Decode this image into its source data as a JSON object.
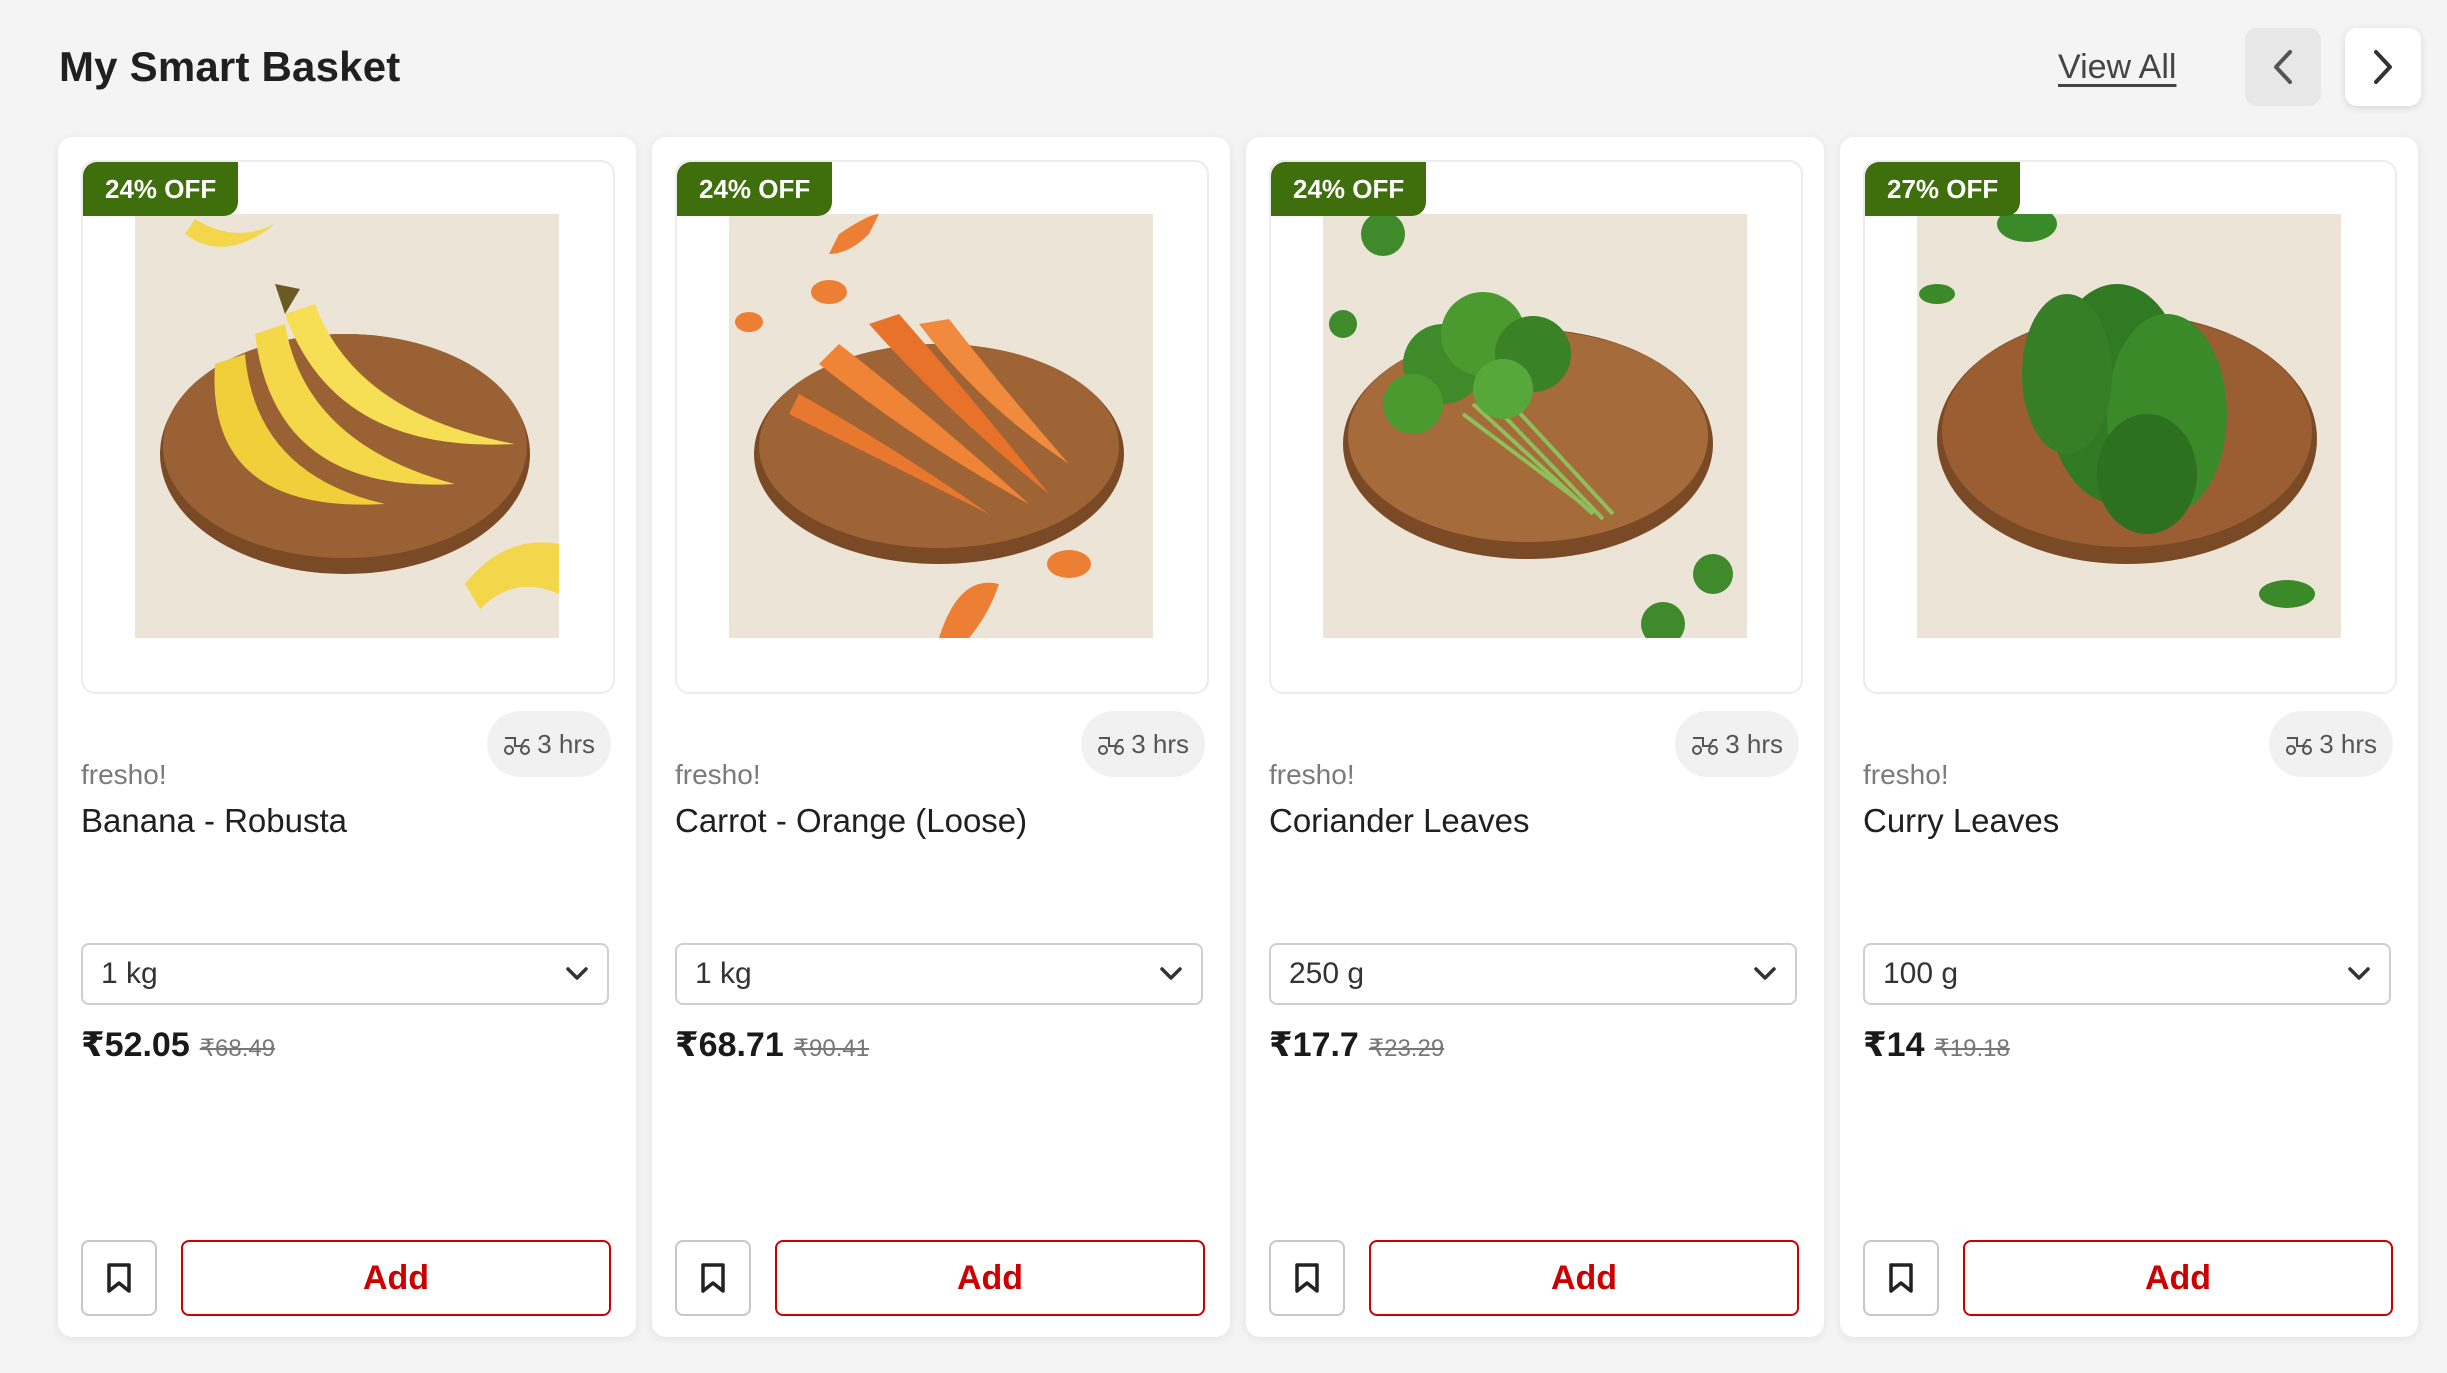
{
  "section": {
    "title": "My Smart Basket",
    "view_all": "View All"
  },
  "products": [
    {
      "badge": "24% OFF",
      "delivery": "3 hrs",
      "brand": "fresho!",
      "name": "Banana - Robusta",
      "variant": "1 kg",
      "price": "₹52.05",
      "mrp": "₹68.49",
      "add_label": "Add",
      "image": "banana-image"
    },
    {
      "badge": "24% OFF",
      "delivery": "3 hrs",
      "brand": "fresho!",
      "name": "Carrot - Orange (Loose)",
      "variant": "1 kg",
      "price": "₹68.71",
      "mrp": "₹90.41",
      "add_label": "Add",
      "image": "carrot-image"
    },
    {
      "badge": "24% OFF",
      "delivery": "3 hrs",
      "brand": "fresho!",
      "name": "Coriander Leaves",
      "variant": "250 g",
      "price": "₹17.7",
      "mrp": "₹23.29",
      "add_label": "Add",
      "image": "coriander-image"
    },
    {
      "badge": "27% OFF",
      "delivery": "3 hrs",
      "brand": "fresho!",
      "name": "Curry Leaves",
      "variant": "100 g",
      "price": "₹14",
      "mrp": "₹19.18",
      "add_label": "Add",
      "image": "curry-leaves-image"
    }
  ],
  "colors": {
    "badge_green": "#3f6f0c",
    "add_red": "#cc0000",
    "background": "#f4f4f4"
  }
}
